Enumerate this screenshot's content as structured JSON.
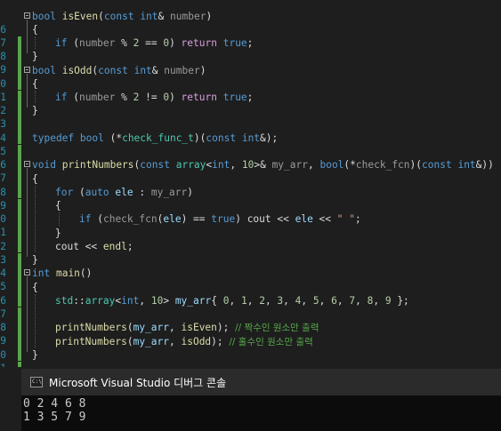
{
  "editor": {
    "line_numbers": [
      "6",
      "7",
      "8",
      "9",
      "0",
      "1",
      "2",
      "3",
      "4",
      "5",
      "6",
      "7",
      "8",
      "9",
      "0",
      "1",
      "2",
      "3",
      "4",
      "5",
      "6",
      "7",
      "8",
      "9",
      "0",
      "1",
      "2"
    ],
    "code": {
      "is_even_sig": [
        "bool",
        "isEven",
        "(",
        "const",
        "int",
        "& ",
        "number",
        ")"
      ],
      "is_even_body": [
        "if",
        " (",
        "number",
        " % ",
        "2",
        " == ",
        "0",
        ") ",
        "return",
        " ",
        "true",
        ";"
      ],
      "is_odd_sig": [
        "bool",
        "isOdd",
        "(",
        "const",
        "int",
        "& ",
        "number",
        ")"
      ],
      "is_odd_body": [
        "if",
        " (",
        "number",
        " % ",
        "2",
        " != ",
        "0",
        ") ",
        "return",
        " ",
        "true",
        ";"
      ],
      "typedef_line": [
        "typedef",
        " ",
        "bool",
        " (*",
        "check_func_t",
        ")(",
        "const",
        " ",
        "int",
        "&);"
      ],
      "print_sig": [
        "void",
        " ",
        "printNumbers",
        "(",
        "const",
        " ",
        "array",
        "<",
        "int",
        ", ",
        "10",
        ">& ",
        "my_arr",
        ", ",
        "bool",
        "(*",
        "check_fcn",
        ")(",
        "const",
        " ",
        "int",
        "&))"
      ],
      "for_line": [
        "for",
        " (",
        "auto",
        " ",
        "ele",
        " : ",
        "my_arr",
        ")"
      ],
      "if_line": [
        "if",
        " (",
        "check_fcn",
        "(",
        "ele",
        ") == ",
        "true",
        ") ",
        "cout",
        " << ",
        "ele",
        " << ",
        "\" \"",
        ";"
      ],
      "cout_endl": [
        "cout",
        " << ",
        "endl",
        ";"
      ],
      "main_sig": [
        "int",
        " ",
        "main",
        "()"
      ],
      "array_decl": [
        "std",
        "::",
        "array",
        "<",
        "int",
        ", ",
        "10",
        "> ",
        "my_arr",
        "{ ",
        "0",
        ", ",
        "1",
        ", ",
        "2",
        ", ",
        "3",
        ", ",
        "4",
        ", ",
        "5",
        ", ",
        "6",
        ", ",
        "7",
        ", ",
        "8",
        ", ",
        "9",
        " };"
      ],
      "call_even": [
        "printNumbers",
        "(",
        "my_arr",
        ", ",
        "isEven",
        "); ",
        "// 짝수인 원소만 출력"
      ],
      "call_odd": [
        "printNumbers",
        "(",
        "my_arr",
        ", ",
        "isOdd",
        "); ",
        "// 홀수인 원소만 출력"
      ],
      "open_brace": "{",
      "close_brace": "}"
    }
  },
  "console": {
    "title": "Microsoft Visual Studio 디버그 콘솔",
    "output": [
      "0 2 4 6 8",
      "1 3 5 7 9"
    ]
  },
  "colors": {
    "keyword": "#569cd6",
    "function": "#dcdcaa",
    "type": "#4ec9b0",
    "comment": "#57a64a",
    "string": "#d69d85",
    "number": "#b5cea8",
    "parameter": "#9a9a9a",
    "local": "#9cdcfe",
    "line_number": "#2b91af",
    "change_bar": "#57a64a",
    "background": "#1e1e1e"
  }
}
